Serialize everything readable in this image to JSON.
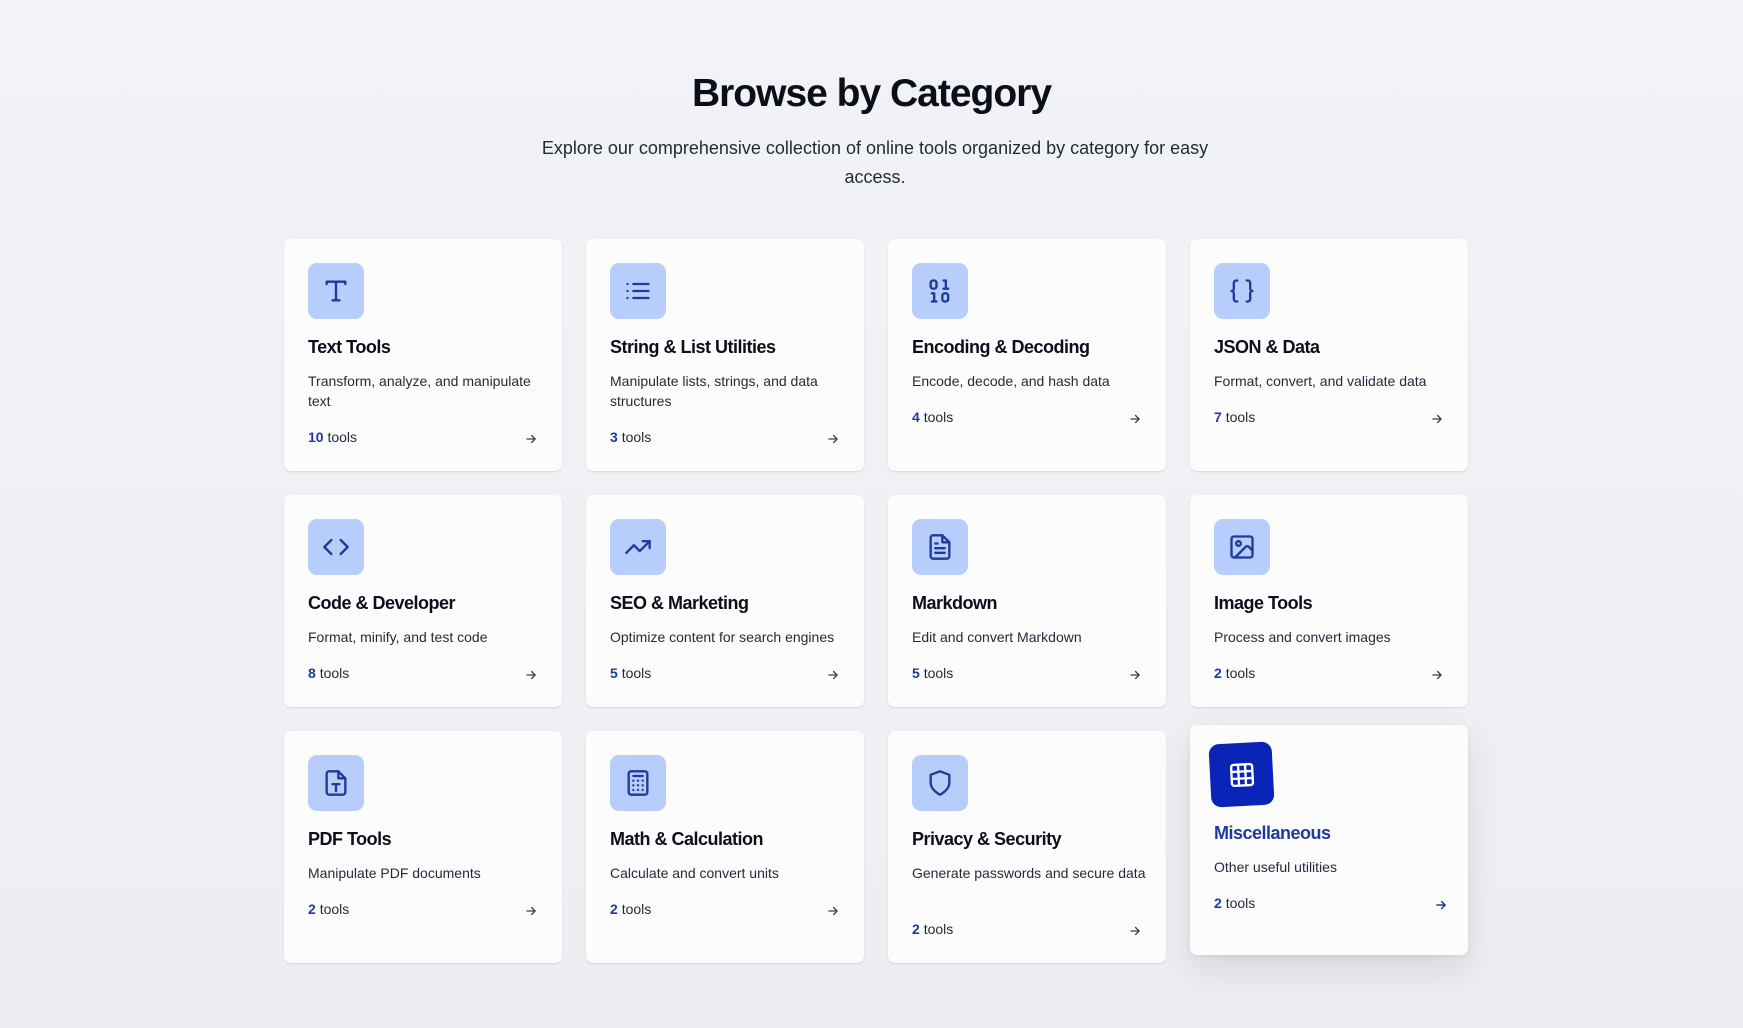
{
  "page": {
    "title": "Browse by Category",
    "subtitle": "Explore our comprehensive collection of online tools organized by category for easy access.",
    "tools_suffix": "tools"
  },
  "categories": [
    {
      "name": "Text Tools",
      "description": "Transform, analyze, and manipulate text",
      "count": "10",
      "icon": "text-icon"
    },
    {
      "name": "String & List Utilities",
      "description": "Manipulate lists, strings, and data structures",
      "count": "3",
      "icon": "list-icon"
    },
    {
      "name": "Encoding & Decoding",
      "description": "Encode, decode, and hash data",
      "count": "4",
      "icon": "binary-icon"
    },
    {
      "name": "JSON & Data",
      "description": "Format, convert, and validate data",
      "count": "7",
      "icon": "braces-icon"
    },
    {
      "name": "Code & Developer",
      "description": "Format, minify, and test code",
      "count": "8",
      "icon": "code-icon"
    },
    {
      "name": "SEO & Marketing",
      "description": "Optimize content for search engines",
      "count": "5",
      "icon": "trending-up-icon"
    },
    {
      "name": "Markdown",
      "description": "Edit and convert Markdown",
      "count": "5",
      "icon": "document-icon"
    },
    {
      "name": "Image Tools",
      "description": "Process and convert images",
      "count": "2",
      "icon": "image-icon"
    },
    {
      "name": "PDF Tools",
      "description": "Manipulate PDF documents",
      "count": "2",
      "icon": "pdf-file-icon"
    },
    {
      "name": "Math & Calculation",
      "description": "Calculate and convert units",
      "count": "2",
      "icon": "calculator-icon"
    },
    {
      "name": "Privacy & Security",
      "description": "Generate passwords and secure data",
      "count": "2",
      "icon": "shield-icon"
    },
    {
      "name": "Miscellaneous",
      "description": "Other useful utilities",
      "count": "2",
      "icon": "grid-icon"
    }
  ],
  "colors": {
    "accent": "#1e3a9e",
    "icon_bg": "#b7cdfb",
    "active_icon_bg": "#0b24b8"
  }
}
